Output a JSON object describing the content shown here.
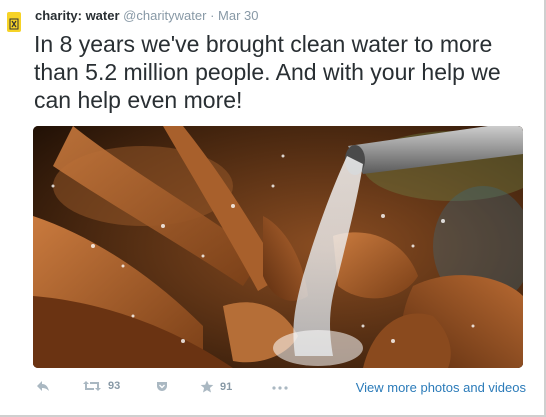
{
  "tweet": {
    "display_name": "charity: water",
    "handle": "@charitywater",
    "separator": "·",
    "date": "Mar 30",
    "text": "In 8 years we've brought clean water to more than 5.2 million people. And with your help we can help even more!"
  },
  "media": {
    "icon": "photo-of-hands-catching-water"
  },
  "actions": {
    "reply_icon": "reply-icon",
    "retweet_icon": "retweet-icon",
    "retweet_count": "93",
    "pocket_icon": "pocket-icon",
    "favorite_icon": "star-icon",
    "favorite_count": "91",
    "more_icon": "more-icon",
    "view_more": "View more photos and videos"
  },
  "colors": {
    "name": "#292f33",
    "meta": "#8899a6",
    "link": "#2b7bb9",
    "avatar": "#f6d327"
  }
}
